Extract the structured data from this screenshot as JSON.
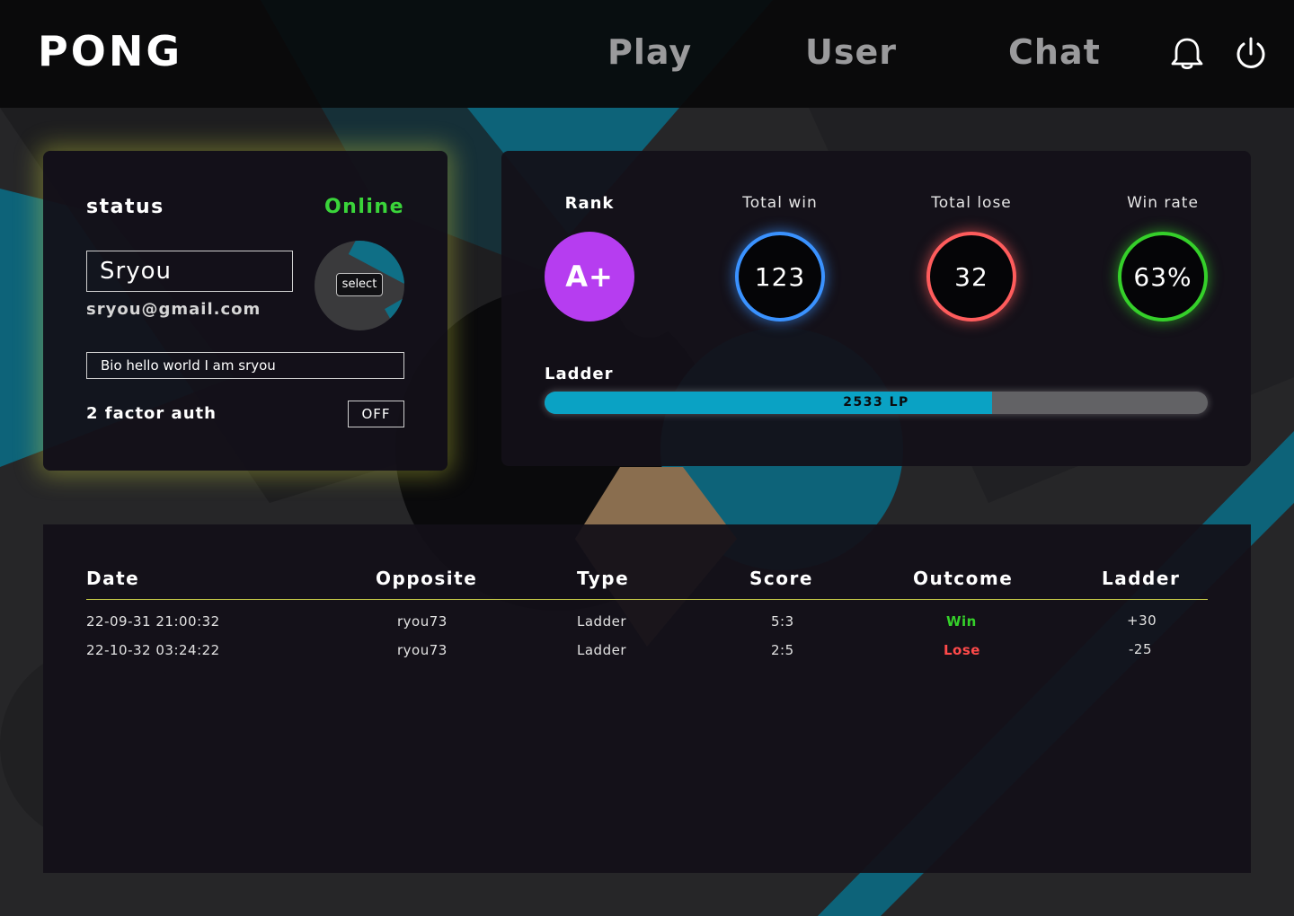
{
  "header": {
    "logo": "PONG",
    "nav": [
      "Play",
      "User",
      "Chat"
    ]
  },
  "profile": {
    "status_label": "status",
    "status_value": "Online",
    "username": "Sryou",
    "email": "sryou@gmail.com",
    "avatar_button": "select",
    "bio": "Bio hello world I am sryou",
    "tfa_label": "2 factor auth",
    "tfa_value": "OFF"
  },
  "stats": {
    "rank_label": "Rank",
    "rank_value": "A+",
    "total_win_label": "Total win",
    "total_win": "123",
    "total_lose_label": "Total lose",
    "total_lose": "32",
    "win_rate_label": "Win rate",
    "win_rate": "63%",
    "ladder_label": "Ladder",
    "ladder_text": "2533 LP",
    "ladder_progress": 0.675
  },
  "history": {
    "headers": [
      "Date",
      "Opposite",
      "Type",
      "Score",
      "Outcome",
      "Ladder"
    ],
    "rows": [
      {
        "date": "22-09-31 21:00:32",
        "opposite": "ryou73",
        "type": "Ladder",
        "score": "5:3",
        "outcome": "Win",
        "ladder": "+30"
      },
      {
        "date": "22-10-32 03:24:22",
        "opposite": "ryou73",
        "type": "Ladder",
        "score": "2:5",
        "outcome": "Lose",
        "ladder": "-25"
      }
    ]
  },
  "colors": {
    "online": "#3ad43a",
    "rank": "#b63df0",
    "win_ring": "#3a92ff",
    "lose_ring": "#ff5c5c",
    "rate_ring": "#35d02a",
    "ladder_fill": "#0aa2c4",
    "profile_glow": "#cdd63c",
    "table_rule": "#c8cc48"
  },
  "icons": {
    "notification": "bell-icon",
    "logout": "power-icon"
  }
}
